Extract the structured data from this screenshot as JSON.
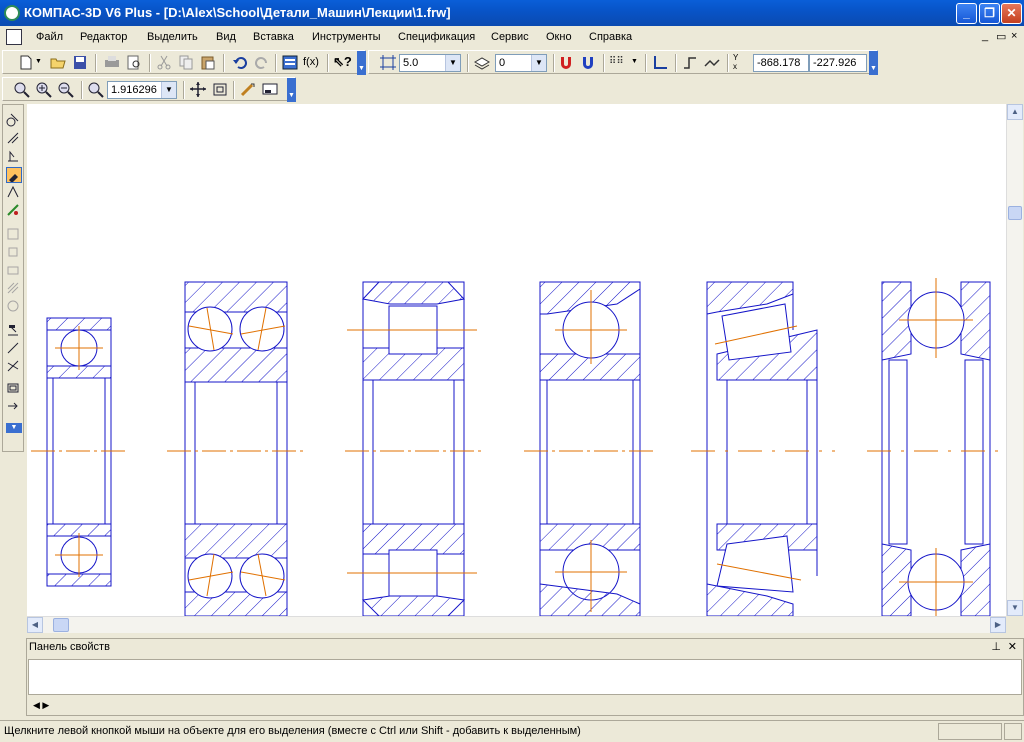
{
  "window": {
    "title": "КОМПАС-3D V6 Plus - [D:\\Alex\\School\\Детали_Машин\\Лекции\\1.frw]"
  },
  "menu": {
    "items": [
      "Файл",
      "Редактор",
      "Выделить",
      "Вид",
      "Вставка",
      "Инструменты",
      "Спецификация",
      "Сервис",
      "Окно",
      "Справка"
    ],
    "mdi_controls": [
      "_",
      "▭",
      "×"
    ]
  },
  "toolbar": {
    "step_value": "5.0",
    "layer_value": "0",
    "coord_x": "-868.178",
    "coord_y": "-227.926",
    "zoom_value": "1.916296"
  },
  "panel": {
    "title": "Панель свойств"
  },
  "status": {
    "text": "Щелкните левой кнопкой мыши на объекте для его выделения (вместе с Ctrl или Shift - добавить к выделенным)"
  },
  "colors": {
    "outline": "#1414c8",
    "centerline": "#e07000",
    "hatch": "#1414c8",
    "titlebar": "#0854c8"
  }
}
